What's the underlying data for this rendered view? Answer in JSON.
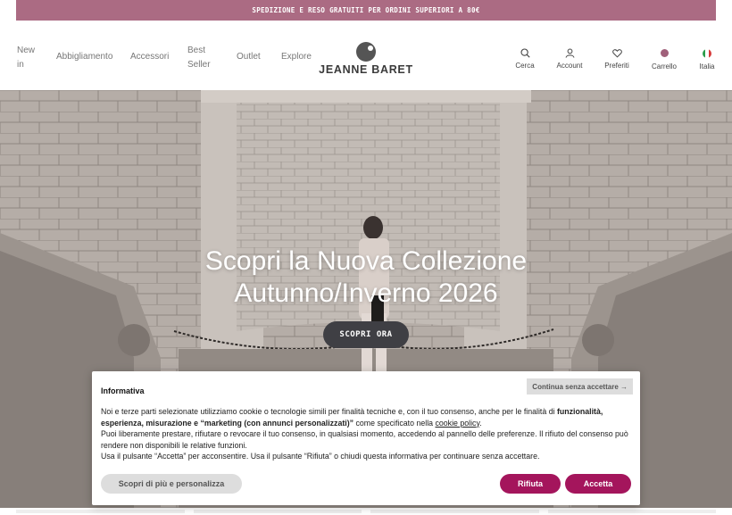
{
  "announcement": "SPEDIZIONE E RESO GRATUITI PER ORDINI SUPERIORI A 80€",
  "nav": [
    "New in",
    "Abbigliamento",
    "Accessori",
    "Best Seller",
    "Outlet",
    "Explore"
  ],
  "brand": "JEANNE BARET",
  "utility": {
    "search": "Cerca",
    "account": "Account",
    "wishlist": "Preferiti",
    "cart": "Carrello",
    "country": "Italia"
  },
  "hero": {
    "title_line1": "Scopri la Nuova Collezione",
    "title_line2": "Autunno/Inverno 2026",
    "cta": "SCOPRI ORA"
  },
  "cookie": {
    "title": "Informativa",
    "skip": "Continua senza accettare →",
    "p1_a": "Noi e terze parti selezionate utilizziamo cookie o tecnologie simili per finalità tecniche e, con il tuo consenso, anche per le finalità di ",
    "p1_b": "funzionalità, esperienza, misurazione e “marketing (con annunci personalizzati)”",
    "p1_c": " come specificato nella ",
    "p1_link": "cookie policy",
    "p1_d": ".",
    "p2": "Puoi liberamente prestare, rifiutare o revocare il tuo consenso, in qualsiasi momento, accedendo al pannello delle preferenze. Il rifiuto del consenso può rendere non disponibili le relative funzioni.",
    "p3": "Usa il pulsante “Accetta” per acconsentire. Usa il pulsante “Rifiuta” o chiudi questa informativa per continuare senza accettare.",
    "more_button": "Scopri di più e personalizza",
    "reject_button": "Rifiuta",
    "accept_button": "Accetta"
  },
  "colors": {
    "announcement_bg": "#ab6b83",
    "primary_button": "#a4155c",
    "cta_bg": "#3f3f44"
  },
  "icons": [
    "search-icon",
    "user-icon",
    "heart-icon",
    "cart-dot-icon",
    "italy-flag-icon"
  ]
}
